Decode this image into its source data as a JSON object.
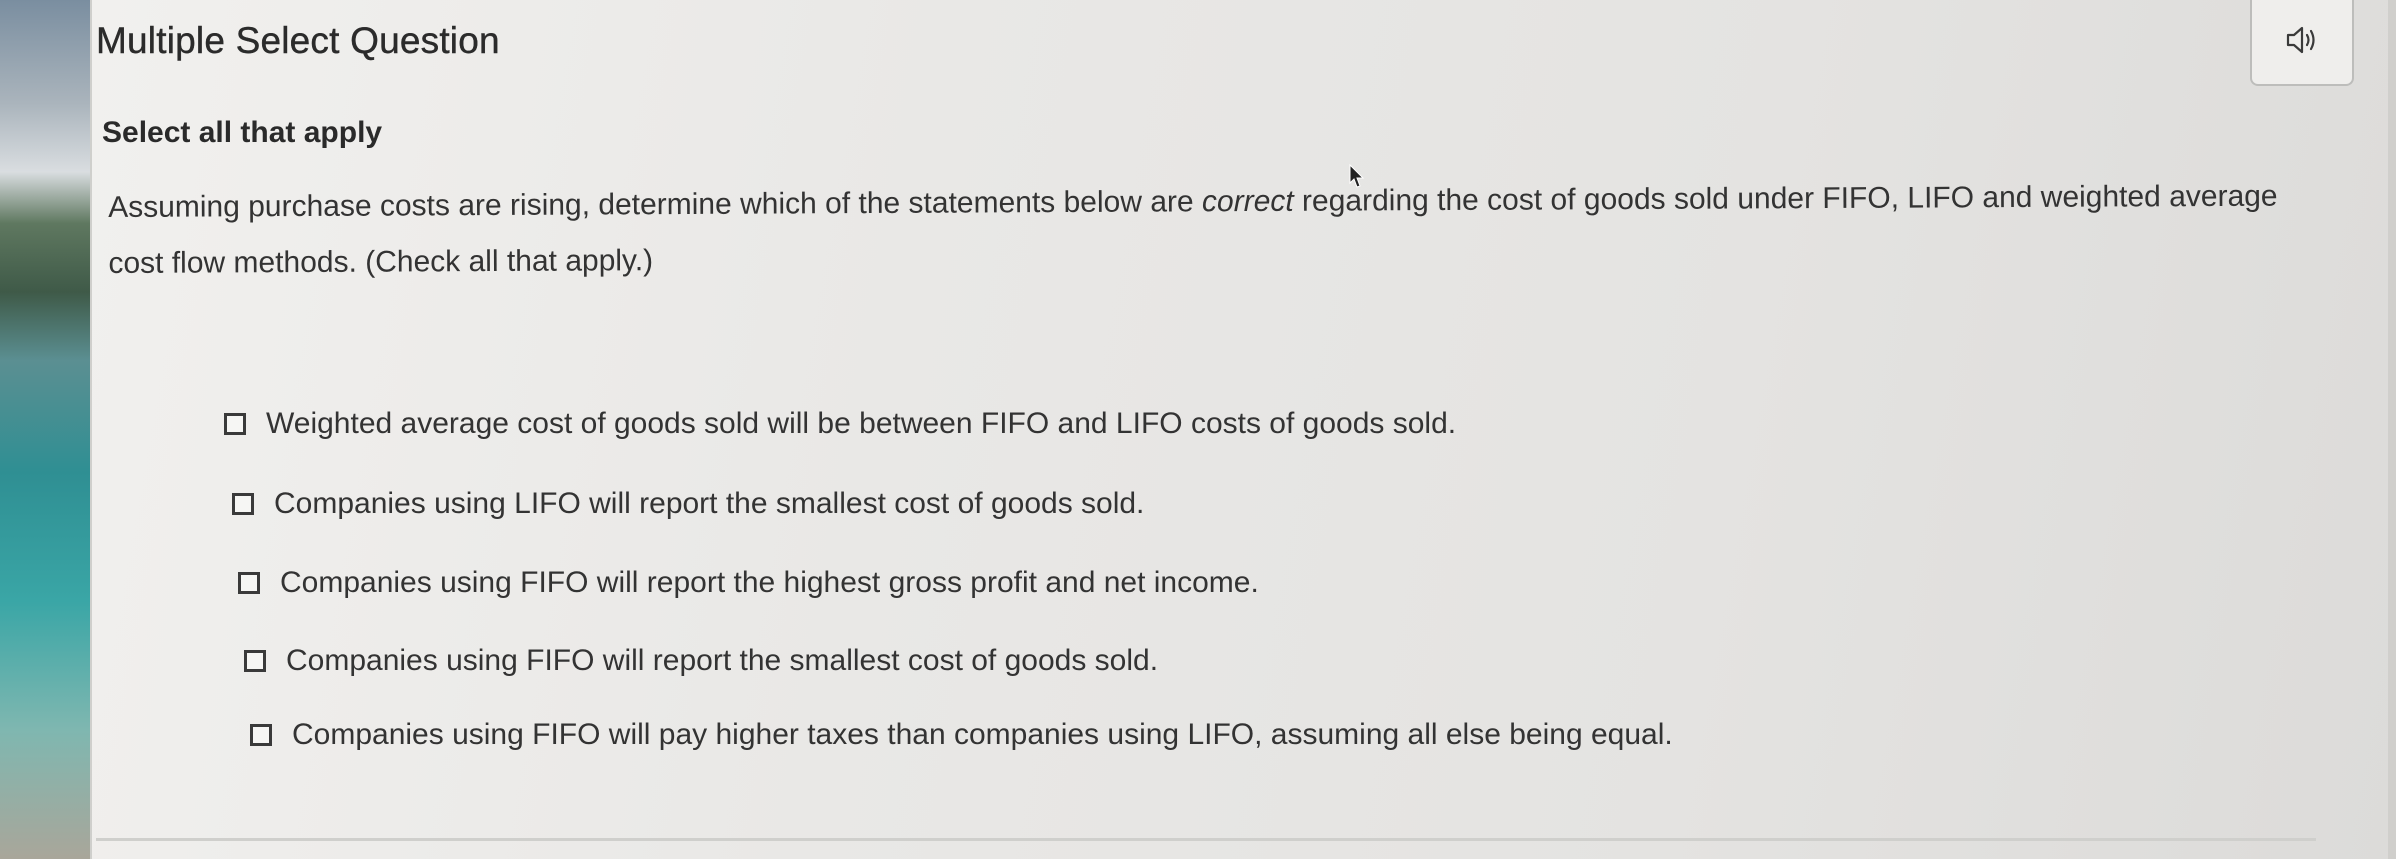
{
  "header": {
    "question_type": "Multiple Select Question",
    "audio_icon": "speaker-icon"
  },
  "instruction": "Select all that apply",
  "prompt": {
    "before": "Assuming purchase costs are rising, determine which of the statements below are ",
    "emphasis": "correct",
    "after": " regarding the cost of goods sold under FIFO, LIFO and weighted average cost flow methods. (Check all that apply.)"
  },
  "options": [
    {
      "label": "Weighted average cost of goods sold will be between FIFO and LIFO costs of goods sold.",
      "checked": false
    },
    {
      "label": "Companies using LIFO will report the smallest cost of goods sold.",
      "checked": false
    },
    {
      "label": "Companies using FIFO will report the highest gross profit and net income.",
      "checked": false
    },
    {
      "label": "Companies using FIFO will report the smallest cost of goods sold.",
      "checked": false
    },
    {
      "label": "Companies using FIFO will pay higher taxes than companies using LIFO, assuming all else being equal.",
      "checked": false
    }
  ],
  "colors": {
    "panel_background": "#ebeae8",
    "text": "#333333",
    "checkbox_border": "#3a3a3a"
  }
}
